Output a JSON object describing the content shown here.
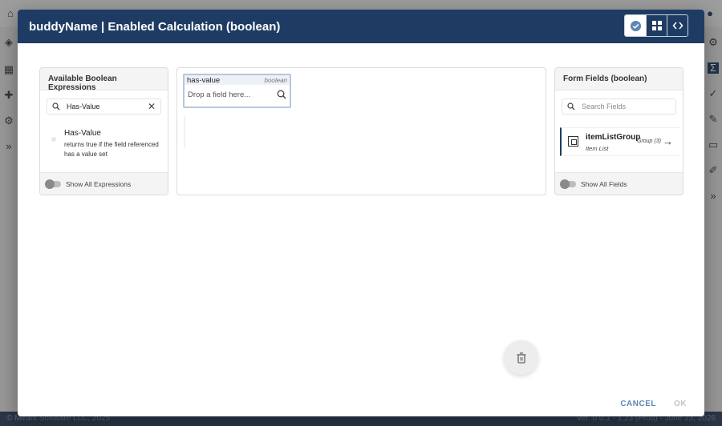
{
  "dialog": {
    "title": "buddyName | Enabled Calculation (boolean)",
    "tools": [
      {
        "icon": "check-circle-icon",
        "active": true
      },
      {
        "icon": "blocks-icon",
        "active": false
      },
      {
        "icon": "code-icon",
        "active": false
      }
    ],
    "cancel_label": "CANCEL",
    "ok_label": "OK"
  },
  "expressions_panel": {
    "title": "Available Boolean Expressions",
    "search_value": "Has-Value",
    "items": [
      {
        "name": "Has-Value",
        "description": "returns true if the field referenced has a value set"
      }
    ],
    "show_all_label": "Show All Expressions"
  },
  "editor": {
    "drop_box": {
      "name": "has-value",
      "type": "boolean",
      "placeholder": "Drop a field here..."
    }
  },
  "fields_panel": {
    "title": "Form Fields (boolean)",
    "search_placeholder": "Search Fields",
    "items": [
      {
        "name": "itemListGroup",
        "subtype": "Item List",
        "meta": "Group (3)"
      }
    ],
    "show_all_label": "Show All Fields"
  },
  "footer": {
    "left": "© Mirant Software LLC, 2025",
    "right": "Ver. 0.0.1 - 1.23 (Prod) - June 23, 2026"
  },
  "colors": {
    "header": "#1e3c63",
    "accent": "#5f86b4"
  }
}
